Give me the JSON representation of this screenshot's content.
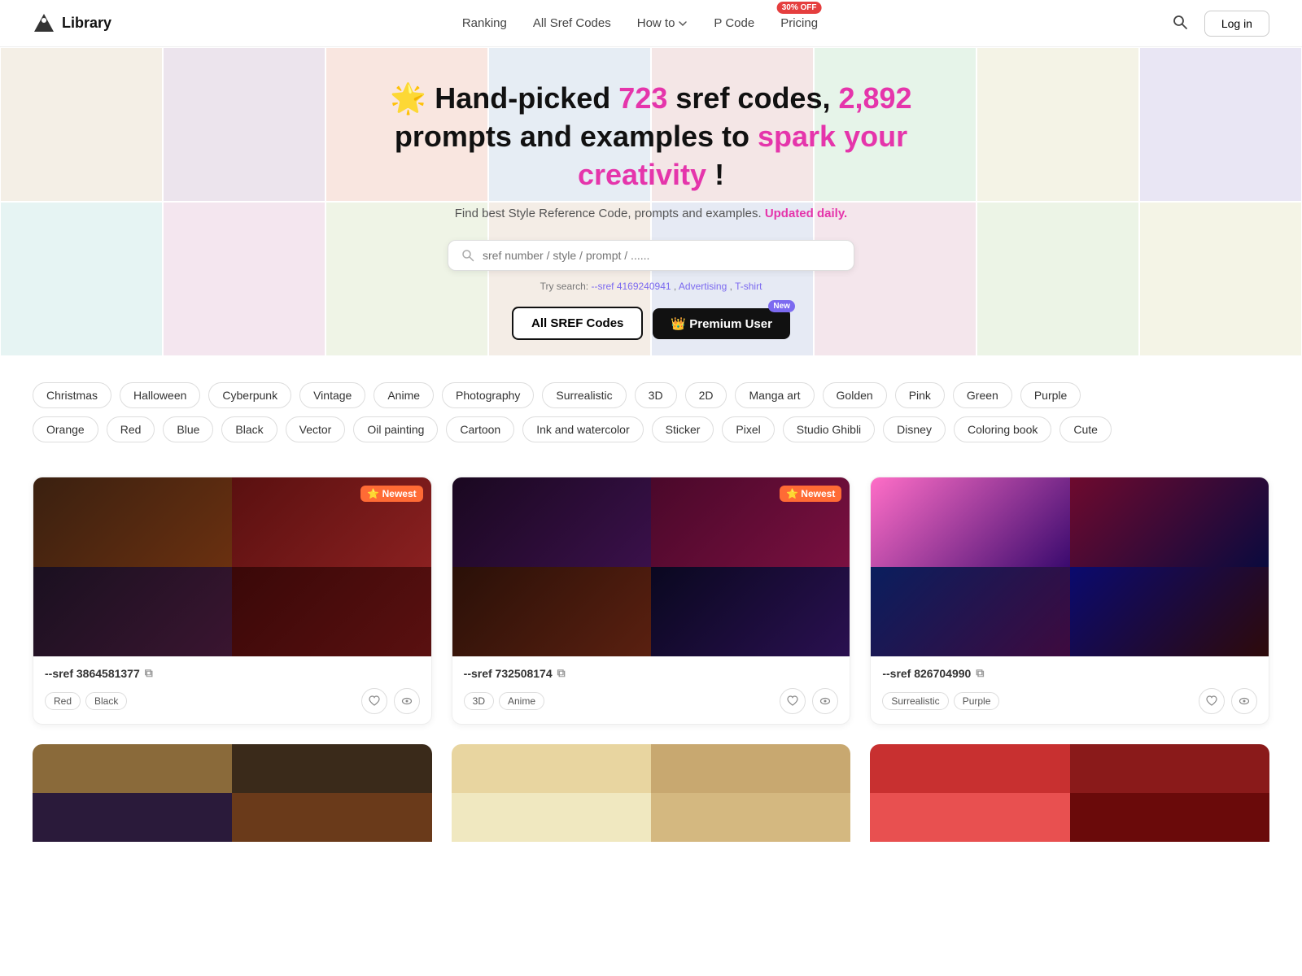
{
  "nav": {
    "logo_text": "Library",
    "links": [
      {
        "id": "ranking",
        "label": "Ranking"
      },
      {
        "id": "all-sref-codes",
        "label": "All Sref Codes"
      },
      {
        "id": "how-to",
        "label": "How to"
      },
      {
        "id": "p-code",
        "label": "P Code"
      },
      {
        "id": "pricing",
        "label": "Pricing"
      }
    ],
    "pricing_badge": "30% OFF",
    "login_label": "Log in"
  },
  "hero": {
    "sun_emoji": "🌟",
    "title_pre": "Hand-picked ",
    "num1": "723",
    "title_mid": " sref codes, ",
    "num2": "2,892",
    "title_post": " prompts and examples to ",
    "spark_text": "spark your creativity",
    "title_end": "!",
    "subtitle_pre": "Find best Style Reference Code, prompts and examples.",
    "updated_label": "Updated daily.",
    "search_placeholder": "sref number / style / prompt / ......",
    "try_label": "Try search: ",
    "try_links": [
      "--sref 4169240941",
      "Advertising",
      "T-shirt"
    ],
    "btn_all_sref": "All SREF Codes",
    "btn_premium": "👑 Premium User",
    "btn_premium_badge": "New"
  },
  "tags": {
    "row1": [
      "Christmas",
      "Halloween",
      "Cyberpunk",
      "Vintage",
      "Anime",
      "Photography",
      "Surrealistic",
      "3D",
      "2D",
      "Manga art",
      "Golden",
      "Pink",
      "Green",
      "Purple"
    ],
    "row2": [
      "Orange",
      "Red",
      "Blue",
      "Black",
      "Vector",
      "Oil painting",
      "Cartoon",
      "Ink and watercolor",
      "Sticker",
      "Pixel",
      "Studio Ghibli",
      "Disney",
      "Coloring book",
      "Cute"
    ]
  },
  "cards": [
    {
      "id": "card1",
      "sref": "--sref 3864581377",
      "newest": true,
      "newest_label": "⭐ Newest",
      "tags": [
        "Red",
        "Black"
      ]
    },
    {
      "id": "card2",
      "sref": "--sref 732508174",
      "newest": true,
      "newest_label": "⭐ Newest",
      "tags": [
        "3D",
        "Anime"
      ]
    },
    {
      "id": "card3",
      "sref": "--sref 826704990",
      "newest": false,
      "newest_label": "",
      "tags": [
        "Surrealistic",
        "Purple"
      ]
    }
  ]
}
